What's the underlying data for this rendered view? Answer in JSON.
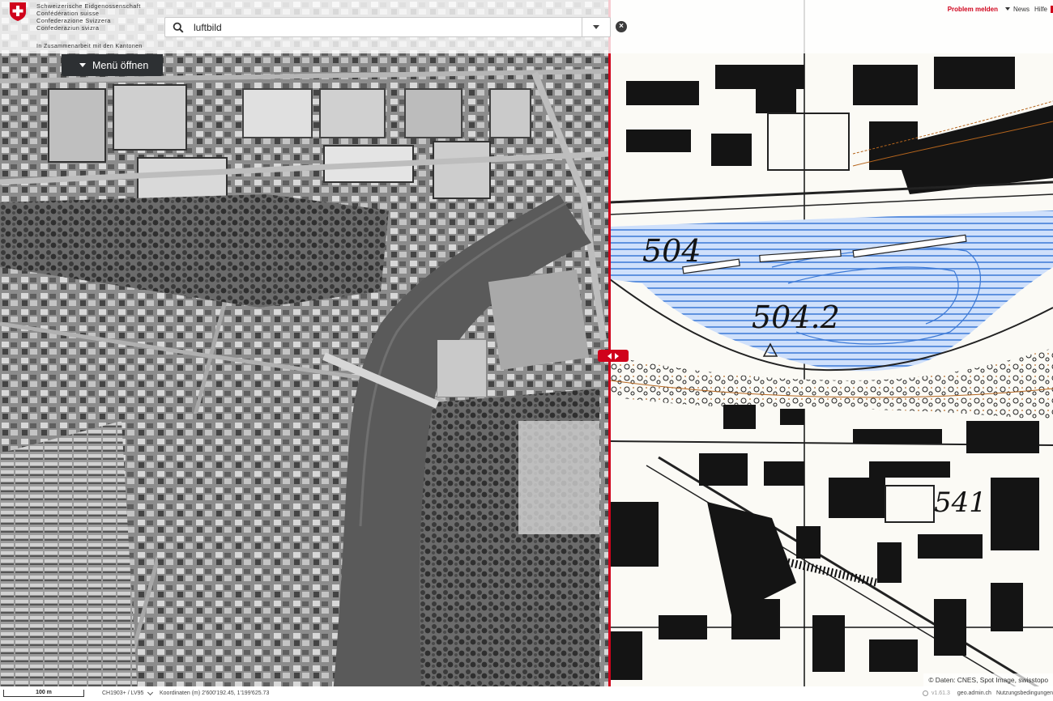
{
  "header": {
    "confederation_lines": [
      "Schweizerische Eidgenossenschaft",
      "Confédération suisse",
      "Confederazione Svizzera",
      "Confederaziun svizra"
    ],
    "cooperation": "In Zusammenarbeit mit den Kantonen"
  },
  "search": {
    "value": "luftbild"
  },
  "topnav": {
    "problem_label": "Problem melden",
    "news_label": "News",
    "help_label": "Hilfe"
  },
  "menu": {
    "label": "Menü öffnen"
  },
  "map": {
    "left_layer": "aerial-photo",
    "right_layer": "historic-topographic-map",
    "elevation_labels": [
      "504",
      "504.2",
      "541"
    ],
    "colors": {
      "accent": "#d0021b",
      "water": "#3a78d6",
      "contour": "#b5651d"
    }
  },
  "attribution": {
    "text": "© Daten: CNES, Spot Image, swisstopo"
  },
  "footer": {
    "scale_label": "100 m",
    "crs_label": "CH1903+ / LV95",
    "coords_label": "Koordinaten (m) 2'600'192.45, 1'199'625.73",
    "version": "v1.61.3",
    "site": "geo.admin.ch",
    "terms": "Nutzungsbedingungen"
  }
}
